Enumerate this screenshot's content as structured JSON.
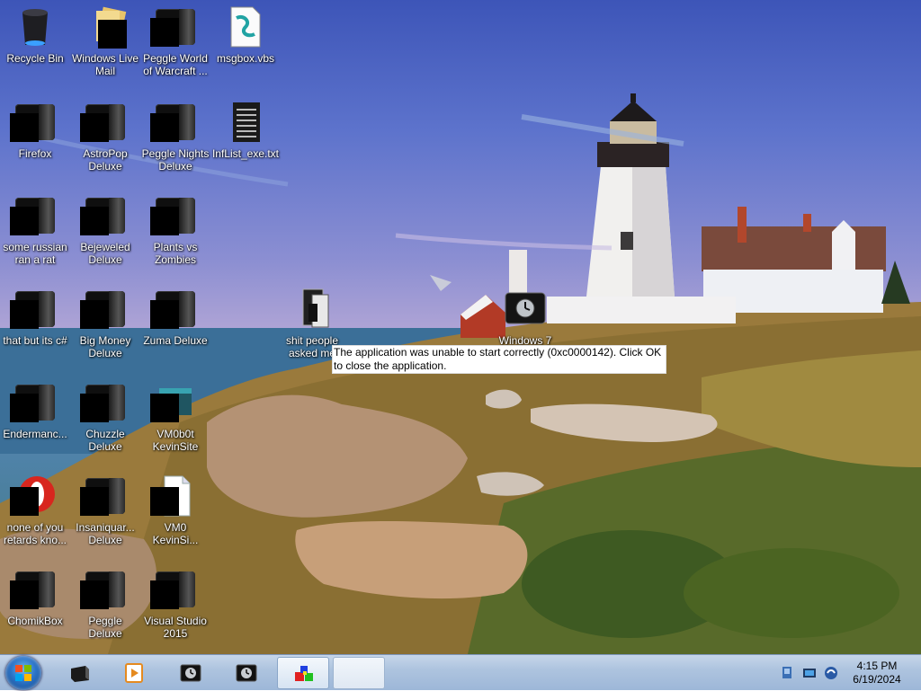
{
  "desktop": {
    "icons": [
      {
        "label": "Recycle Bin"
      },
      {
        "label": "Windows Live\nMail"
      },
      {
        "label": "Peggle World\nof Warcraft ..."
      },
      {
        "label": "msgbox.vbs"
      },
      {
        "label": "Firefox"
      },
      {
        "label": "AstroPop\nDeluxe"
      },
      {
        "label": "Peggle Nights\nDeluxe"
      },
      {
        "label": "InfList_exe.txt"
      },
      {
        "label": "some russian\nran a rat"
      },
      {
        "label": "Bejeweled\nDeluxe"
      },
      {
        "label": "Plants vs\nZombies"
      },
      {
        "label": "that but its c#"
      },
      {
        "label": "Big Money\nDeluxe"
      },
      {
        "label": "Zuma Deluxe"
      },
      {
        "label": "shit people\nasked me"
      },
      {
        "label": "Windows 7"
      },
      {
        "label": "Endermanc..."
      },
      {
        "label": "Chuzzle\nDeluxe"
      },
      {
        "label": "VM0b0t\nKevinSite"
      },
      {
        "label": "none of you\nretards kno..."
      },
      {
        "label": "Insaniquar...\nDeluxe"
      },
      {
        "label": "VM0\nKevinSi..."
      },
      {
        "label": "ChomikBox"
      },
      {
        "label": "Peggle Deluxe"
      },
      {
        "label": "Visual Studio\n2015"
      }
    ]
  },
  "error_message": {
    "text": "The application was unable to start correctly (0xc0000142). Click OK to close the application."
  },
  "taskbar": {
    "start_icon": "windows-orb-icon",
    "buttons": [
      {
        "icon": "app-window-icon"
      },
      {
        "icon": "media-player-icon"
      },
      {
        "icon": "clock-app-icon"
      },
      {
        "icon": "clock-app-icon"
      },
      {
        "icon": "colored-cubes-icon"
      },
      {
        "icon": "blank-window-icon"
      }
    ],
    "tray": {
      "icons": [
        "display-icon",
        "network-icon",
        "volume-icon"
      ]
    },
    "clock": {
      "time": "4:15 PM",
      "date": "6/19/2024"
    }
  }
}
